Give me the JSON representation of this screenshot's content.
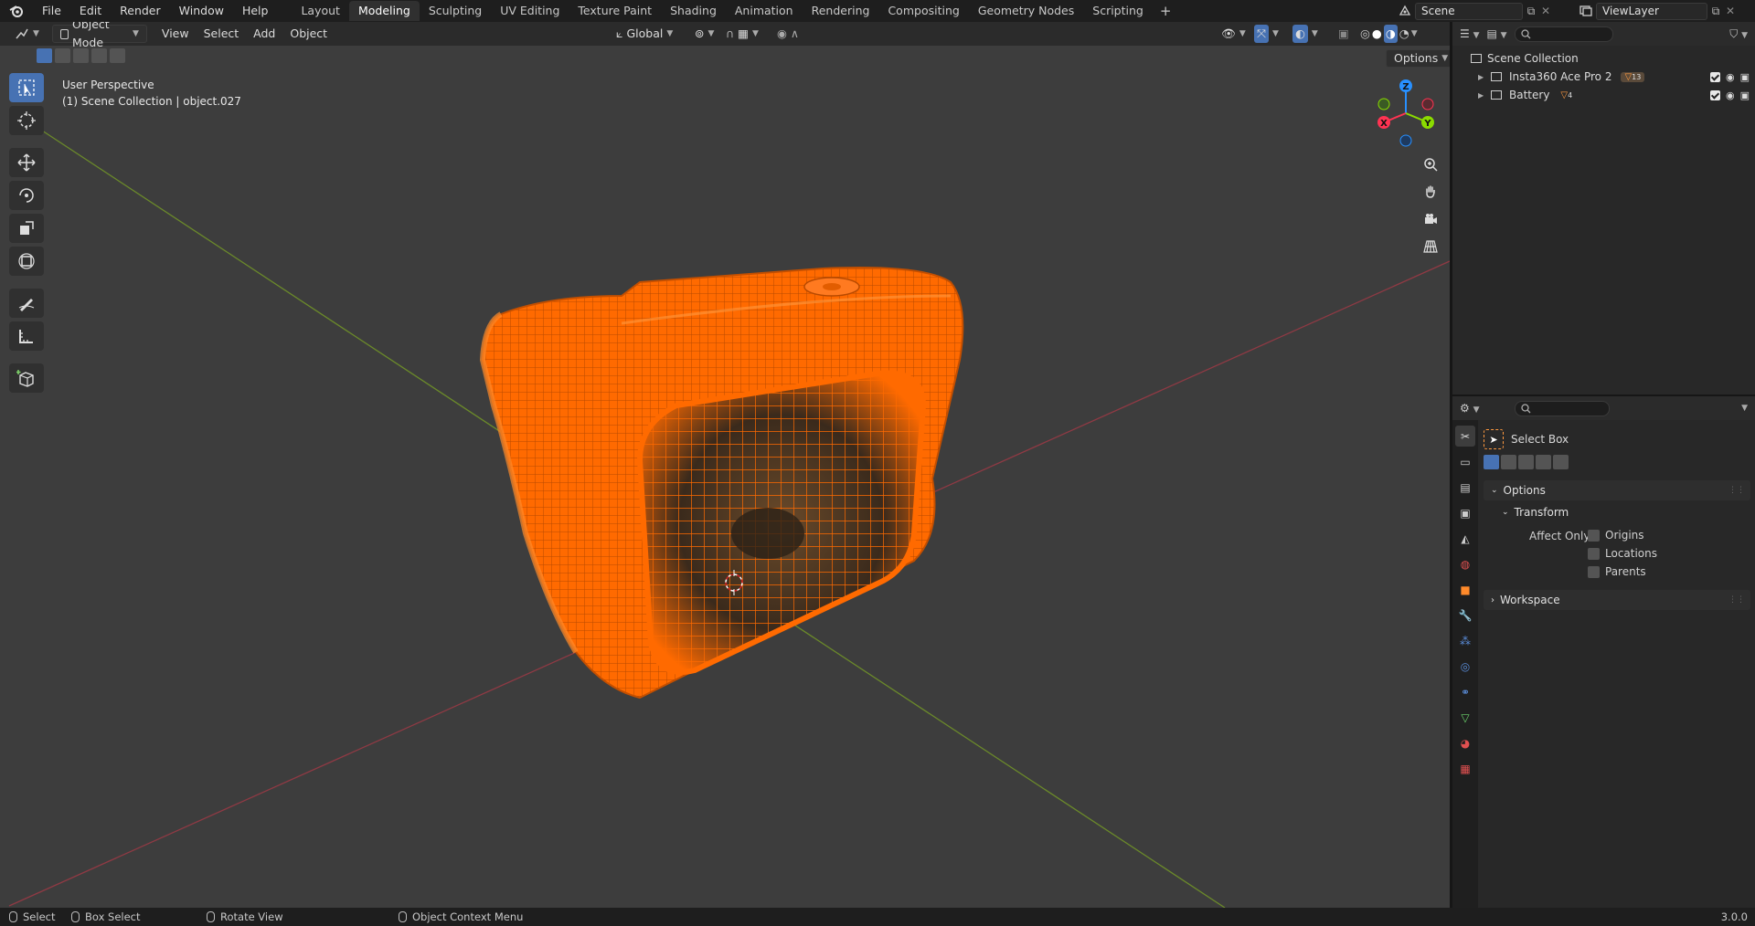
{
  "topbar": {
    "menus": [
      "File",
      "Edit",
      "Render",
      "Window",
      "Help"
    ],
    "workspaces": [
      "Layout",
      "Modeling",
      "Sculpting",
      "UV Editing",
      "Texture Paint",
      "Shading",
      "Animation",
      "Rendering",
      "Compositing",
      "Geometry Nodes",
      "Scripting"
    ],
    "active_workspace": "Modeling",
    "add_symbol": "+",
    "scene": "Scene",
    "view_layer": "ViewLayer"
  },
  "viewport": {
    "mode": "Object Mode",
    "menus": [
      "View",
      "Select",
      "Add",
      "Object"
    ],
    "orientation": "Global",
    "options_label": "Options",
    "perspective": "User Perspective",
    "collection_info": "(1) Scene Collection | object.027",
    "gizmo": {
      "x": "X",
      "y": "Y",
      "z": "Z"
    },
    "colors": {
      "x_axis": "#ff3352",
      "y_axis": "#8bdc00",
      "z_axis": "#2890ff",
      "selection": "#ff6a00"
    }
  },
  "outliner": {
    "root": "Scene Collection",
    "items": [
      {
        "name": "Insta360 Ace Pro 2",
        "badge": "13"
      },
      {
        "name": "Battery",
        "badge": "4"
      }
    ]
  },
  "properties": {
    "tool_name": "Select Box",
    "options_panel": "Options",
    "transform_panel": "Transform",
    "affect_only_label": "Affect Only",
    "checkboxes": [
      "Origins",
      "Locations",
      "Parents"
    ],
    "workspace_panel": "Workspace"
  },
  "statusbar": {
    "select": "Select",
    "box_select": "Box Select",
    "rotate_view": "Rotate View",
    "context_menu": "Object Context Menu",
    "version": "3.0.0"
  }
}
